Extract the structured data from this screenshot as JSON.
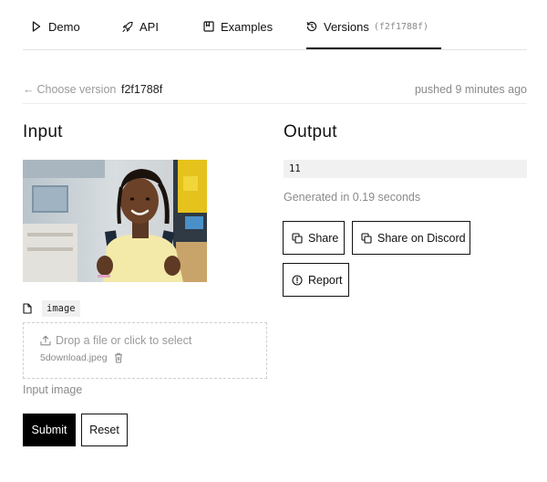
{
  "tabs": [
    {
      "label": "Demo",
      "icon": "play-icon"
    },
    {
      "label": "API",
      "icon": "rocket-icon"
    },
    {
      "label": "Examples",
      "icon": "bookmark-icon"
    },
    {
      "label": "Versions",
      "icon": "history-icon",
      "hash": "(f2f1788f)",
      "active": true
    }
  ],
  "version_bar": {
    "choose_label": "Choose version",
    "version_id": "f2f1788f",
    "pushed": "pushed 9 minutes ago"
  },
  "input": {
    "heading": "Input",
    "image_alt": "Input photo: smiling girl with braided hair and a backpack in a classroom",
    "field_name": "image",
    "drop_text": "Drop a file or click to select",
    "filename": "5download.jpeg",
    "hint": "Input image",
    "submit_label": "Submit",
    "reset_label": "Reset"
  },
  "output": {
    "heading": "Output",
    "value": "11",
    "generated": "Generated in 0.19 seconds",
    "share_label": "Share",
    "discord_label": "Share on Discord",
    "report_label": "Report"
  },
  "colors": {
    "primary_button": "#000000",
    "muted_text": "#8a8a8a",
    "output_bg": "#f1f1f1"
  }
}
